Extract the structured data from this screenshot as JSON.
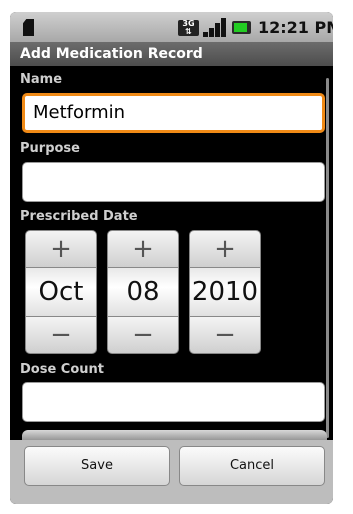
{
  "status_bar": {
    "network_type": "3G",
    "time": "12:21 PM",
    "icons": [
      "sd-card-icon",
      "network-3g-icon",
      "signal-icon",
      "battery-icon"
    ],
    "battery_level_fraction": 0.85,
    "signal_level_bars": 4
  },
  "title_bar": {
    "title": "Add Medication Record"
  },
  "form": {
    "name": {
      "label": "Name",
      "value": "Metformin",
      "focused": true
    },
    "purpose": {
      "label": "Purpose",
      "value": ""
    },
    "prescribed_date": {
      "label": "Prescribed Date",
      "month": "Oct",
      "day": "08",
      "year": "2010",
      "increment_symbol": "+",
      "decrement_symbol": "−"
    },
    "dose_count": {
      "label": "Dose Count",
      "value": ""
    }
  },
  "actions": {
    "save_label": "Save",
    "cancel_label": "Cancel"
  },
  "colors": {
    "focus_border": "#f08a16",
    "battery": "#22cc22",
    "title_bar": "#5a5a5a"
  }
}
